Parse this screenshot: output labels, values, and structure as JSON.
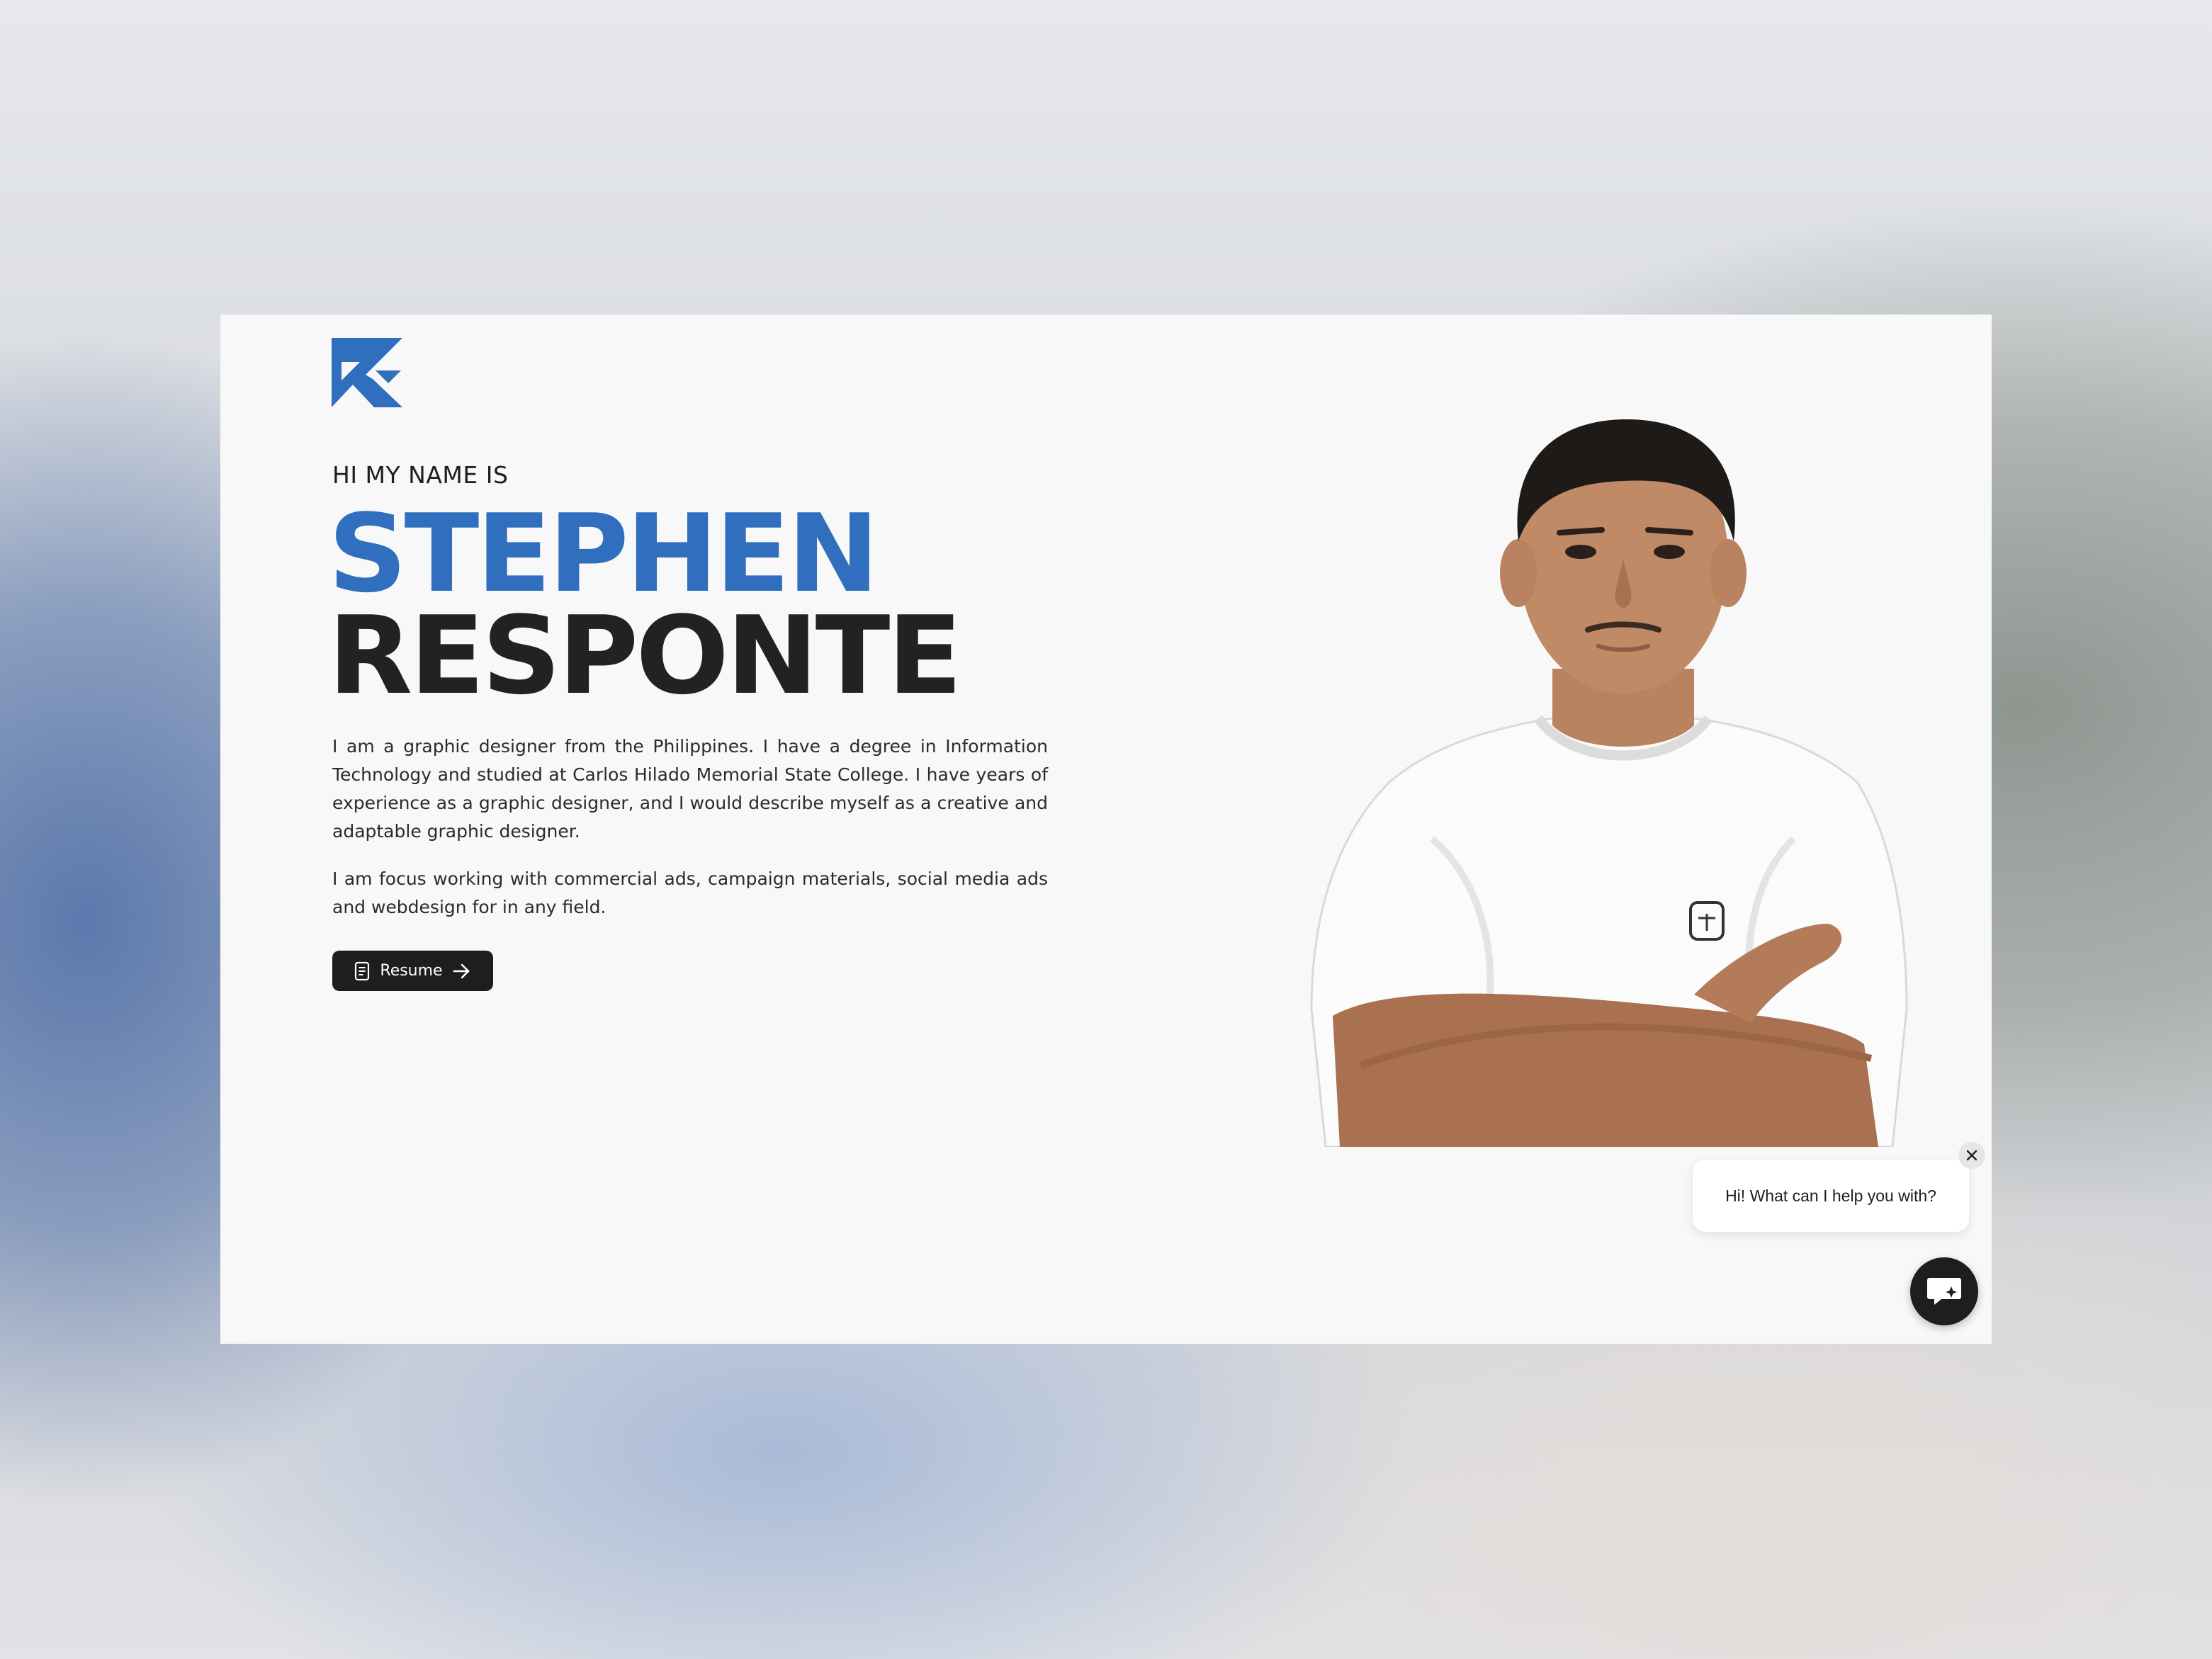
{
  "hero": {
    "intro_label": "HI MY NAME IS",
    "first_name": "STEPHEN",
    "last_name": "RESPONTE",
    "bio": [
      "I am a graphic designer from the Philippines. I have a degree in Information Technology and studied at Carlos Hilado Memorial State College. I have years of experience as a graphic designer, and I would describe myself as a creative and adaptable graphic designer.",
      "I am focus working with commercial ads, campaign materials, social media ads and webdesign for in any field."
    ],
    "resume_button": {
      "label": "Resume",
      "icon": "document-icon",
      "trailing_icon": "arrow-right-icon"
    }
  },
  "logo": {
    "icon": "sr-monogram-logo"
  },
  "portrait": {
    "icon": "portrait-photo"
  },
  "chat": {
    "greeting": "Hi! What can I help you with?",
    "close_icon": "close-icon",
    "launcher_icon": "chat-sparkle-icon"
  },
  "colors": {
    "accent": "#2f6fbe",
    "dark": "#222222",
    "page_bg": "#f8f8f8",
    "button_bg": "#1e1e1e"
  }
}
